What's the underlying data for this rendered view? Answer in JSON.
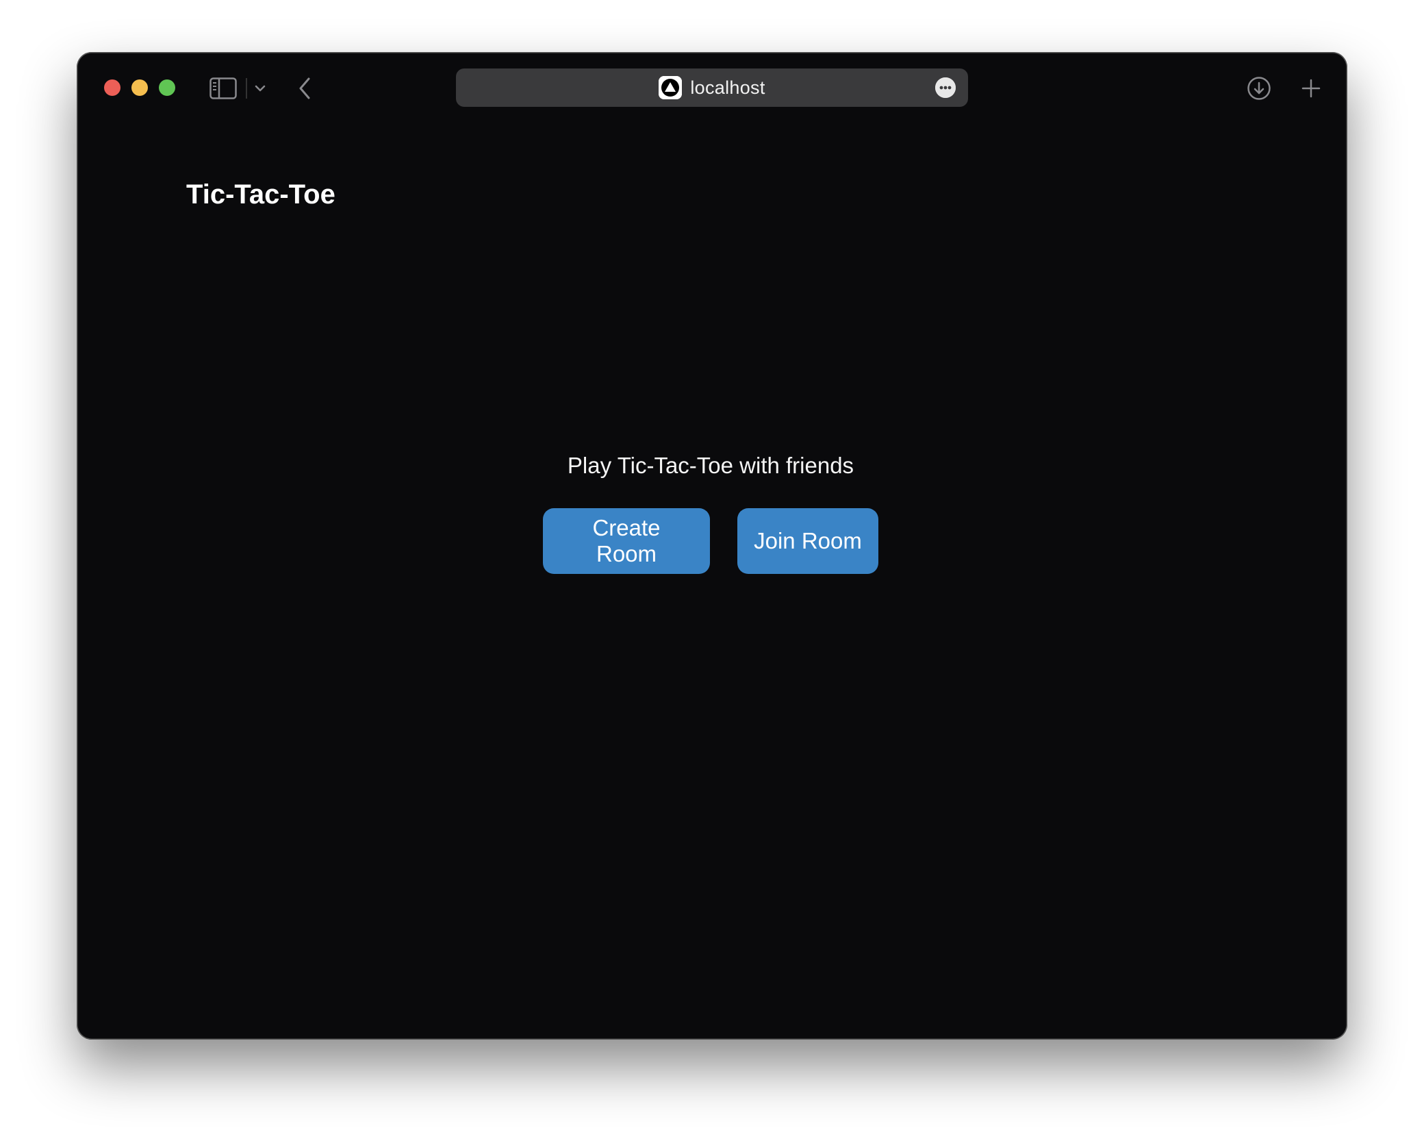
{
  "browser": {
    "address": "localhost",
    "icons": {
      "sidebar": "sidebar-icon",
      "chevron": "chevron-down-icon",
      "back": "back-arrow-icon",
      "site": "triangle-logo-icon",
      "more": "ellipsis-icon",
      "download": "download-icon",
      "new_tab": "plus-icon"
    },
    "traffic_colors": {
      "close": "#ed5f57",
      "minimize": "#f5be4f",
      "zoom": "#60c554"
    }
  },
  "app": {
    "title": "Tic-Tac-Toe",
    "tagline": "Play Tic-Tac-Toe with friends",
    "buttons": {
      "create": "Create Room",
      "join": "Join Room"
    },
    "accent_color": "#3a84c6",
    "background_color": "#0a0a0c"
  }
}
